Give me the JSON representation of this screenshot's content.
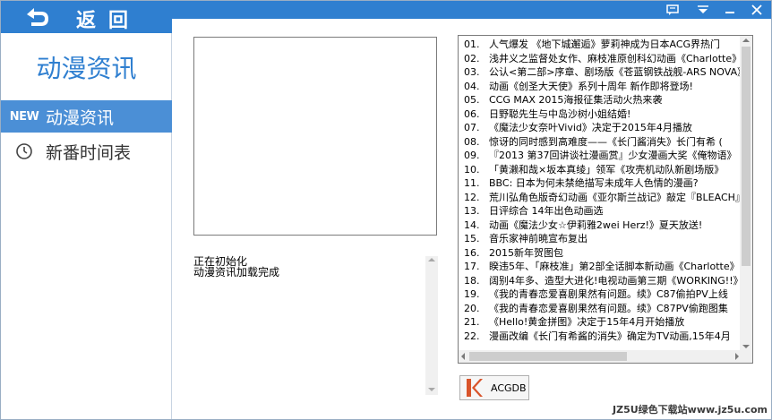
{
  "header": {
    "back_label": "返回"
  },
  "sidebar": {
    "app_title": "动漫资讯",
    "items": [
      {
        "label": "动漫资讯",
        "badge": "NEW",
        "active": true
      },
      {
        "label": "新番时间表",
        "active": false
      }
    ]
  },
  "log": {
    "lines": [
      "正在初始化",
      "动漫资讯加载完成"
    ]
  },
  "news": [
    {
      "num": "01.",
      "title": "人气爆发 《地下城邂逅》萝莉神成为日本ACG界热门"
    },
    {
      "num": "02.",
      "title": "浅井义之监督处女作、麻枝准原创科幻动画《Charlotte》"
    },
    {
      "num": "03.",
      "title": "公认<第二部>序章、剧场版《苍蓝钢铁战舰-ARS NOVA》"
    },
    {
      "num": "04.",
      "title": "动画《创圣大天使》系列十周年 新作即将登场!"
    },
    {
      "num": "05.",
      "title": "CCG MAX 2015海报征集活动火热来袭"
    },
    {
      "num": "06.",
      "title": "日野聪先生与中岛沙树小姐结婚!"
    },
    {
      "num": "07.",
      "title": "《魔法少女奈叶Vivid》决定于2015年4月播放"
    },
    {
      "num": "08.",
      "title": "惊讶的同时感到高难度——《长门酱消失》长门有希 ("
    },
    {
      "num": "09.",
      "title": "『2013 第37回讲谈社漫画赏』少女漫画大奖《俺物语》"
    },
    {
      "num": "10.",
      "title": "「黄濑和哉×坂本真绫」领军《攻壳机动队新剧场版》"
    },
    {
      "num": "11.",
      "title": "BBC: 日本为何未禁绝描写未成年人色情的漫画?"
    },
    {
      "num": "12.",
      "title": "荒川弘角色版奇幻动画《亚尔斯兰战记》敲定『BLEACH』"
    },
    {
      "num": "13.",
      "title": "日评综合 14年出色动画选"
    },
    {
      "num": "14.",
      "title": "动画《魔法少女☆伊莉雅2wei Herz!》夏天放送!"
    },
    {
      "num": "15.",
      "title": "音乐家神前暁宣布复出"
    },
    {
      "num": "16.",
      "title": "2015新年贺图包"
    },
    {
      "num": "17.",
      "title": "睽违5年、「麻枝准」第2部全话脚本新动画《Charlotte》"
    },
    {
      "num": "18.",
      "title": "阔别4年多、造型大进化!电视动画第三期《WORKING!!》"
    },
    {
      "num": "19.",
      "title": "《我的青春恋爱喜剧果然有问题。续》C87偷拍PV上线"
    },
    {
      "num": "20.",
      "title": "《我的青春恋爱喜剧果然有问题。续》C87PV偷跑图集"
    },
    {
      "num": "21.",
      "title": "《Hello!黄金拼图》决定于15年4月开始播放"
    },
    {
      "num": "22.",
      "title": "漫画改编《长门有希酱的消失》确定为TV动画,15年4月"
    }
  ],
  "source": {
    "label": "ACGDB"
  },
  "watermark": "JZ5U绿色下载站www.jz5u.com"
}
